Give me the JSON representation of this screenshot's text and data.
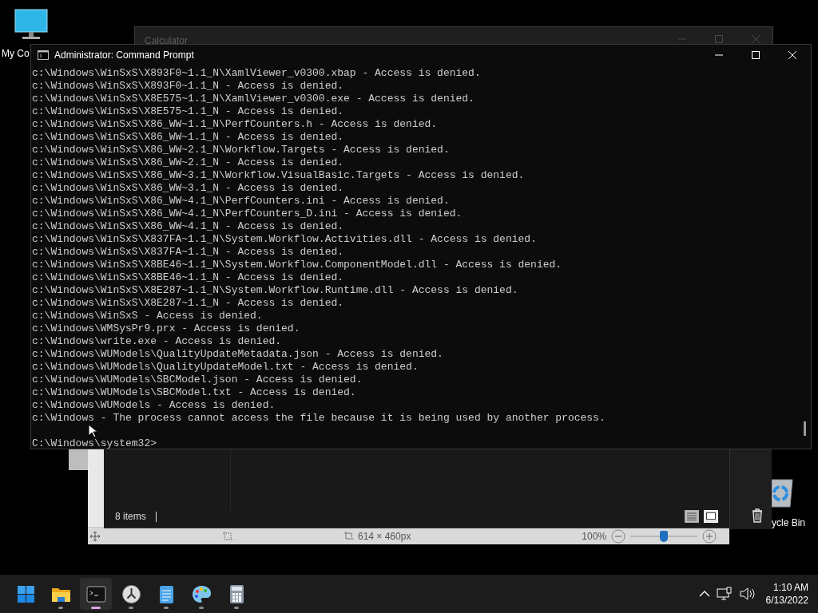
{
  "desktop_icons": [
    {
      "kind": "computer",
      "label": "My Co"
    },
    {
      "kind": "recycle",
      "label": "ycle Bin"
    }
  ],
  "calculator": {
    "title": "Calculator"
  },
  "paint": {
    "dimensions": "614 × 460px",
    "zoom": "100%",
    "zoom_slider": {
      "level": 0.5
    }
  },
  "explorer": {
    "status": "8 items",
    "views": [
      {
        "kind": "details",
        "selected": false
      },
      {
        "kind": "tiles",
        "selected": true
      }
    ]
  },
  "cmd": {
    "title": "Administrator: Command Prompt",
    "lines": [
      "c:\\Windows\\WinSxS\\X893F0~1.1_N\\XamlViewer_v0300.xbap - Access is denied.",
      "c:\\Windows\\WinSxS\\X893F0~1.1_N - Access is denied.",
      "c:\\Windows\\WinSxS\\X8E575~1.1_N\\XamlViewer_v0300.exe - Access is denied.",
      "c:\\Windows\\WinSxS\\X8E575~1.1_N - Access is denied.",
      "c:\\Windows\\WinSxS\\X86_WW~1.1_N\\PerfCounters.h - Access is denied.",
      "c:\\Windows\\WinSxS\\X86_WW~1.1_N - Access is denied.",
      "c:\\Windows\\WinSxS\\X86_WW~2.1_N\\Workflow.Targets - Access is denied.",
      "c:\\Windows\\WinSxS\\X86_WW~2.1_N - Access is denied.",
      "c:\\Windows\\WinSxS\\X86_WW~3.1_N\\Workflow.VisualBasic.Targets - Access is denied.",
      "c:\\Windows\\WinSxS\\X86_WW~3.1_N - Access is denied.",
      "c:\\Windows\\WinSxS\\X86_WW~4.1_N\\PerfCounters.ini - Access is denied.",
      "c:\\Windows\\WinSxS\\X86_WW~4.1_N\\PerfCounters_D.ini - Access is denied.",
      "c:\\Windows\\WinSxS\\X86_WW~4.1_N - Access is denied.",
      "c:\\Windows\\WinSxS\\X837FA~1.1_N\\System.Workflow.Activities.dll - Access is denied.",
      "c:\\Windows\\WinSxS\\X837FA~1.1_N - Access is denied.",
      "c:\\Windows\\WinSxS\\X8BE46~1.1_N\\System.Workflow.ComponentModel.dll - Access is denied.",
      "c:\\Windows\\WinSxS\\X8BE46~1.1_N - Access is denied.",
      "c:\\Windows\\WinSxS\\X8E287~1.1_N\\System.Workflow.Runtime.dll - Access is denied.",
      "c:\\Windows\\WinSxS\\X8E287~1.1_N - Access is denied.",
      "c:\\Windows\\WinSxS - Access is denied.",
      "c:\\Windows\\WMSysPr9.prx - Access is denied.",
      "c:\\Windows\\write.exe - Access is denied.",
      "c:\\Windows\\WUModels\\QualityUpdateMetadata.json - Access is denied.",
      "c:\\Windows\\WUModels\\QualityUpdateModel.txt - Access is denied.",
      "c:\\Windows\\WUModels\\SBCModel.json - Access is denied.",
      "c:\\Windows\\WUModels\\SBCModel.txt - Access is denied.",
      "c:\\Windows\\WUModels - Access is denied.",
      "c:\\Windows - The process cannot access the file because it is being used by another process."
    ],
    "prompt": "C:\\Windows\\system32>"
  },
  "taskbar": {
    "apps": [
      {
        "kind": "start",
        "running": false,
        "selected": false
      },
      {
        "kind": "folder",
        "running": true,
        "selected": false
      },
      {
        "kind": "terminal",
        "running": true,
        "selected": true
      },
      {
        "kind": "clock",
        "running": true,
        "selected": false
      },
      {
        "kind": "notepad",
        "running": true,
        "selected": false
      },
      {
        "kind": "paint",
        "running": true,
        "selected": false
      },
      {
        "kind": "calculator",
        "running": true,
        "selected": false
      }
    ],
    "time": "1:10 AM",
    "date": "6/13/2022"
  }
}
